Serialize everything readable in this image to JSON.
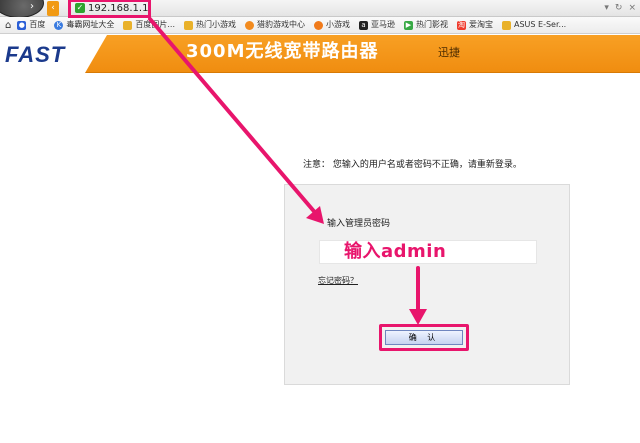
{
  "browser": {
    "url": "192.168.1.1",
    "bookmarks": [
      {
        "label": "百度",
        "icon": "baidu-paw-icon",
        "color": "#2b5fd6"
      },
      {
        "label": "毒霸网址大全",
        "icon": "kingsoft-icon",
        "color": "#3a7be0"
      },
      {
        "label": "百度图片...",
        "icon": "folder-icon",
        "color": "#e9b12a"
      },
      {
        "label": "热门小游戏",
        "icon": "folder-icon",
        "color": "#e9b12a"
      },
      {
        "label": "猎豹游戏中心",
        "icon": "game-icon",
        "color": "#f28b1f"
      },
      {
        "label": "小游戏",
        "icon": "game-icon",
        "color": "#f07a1a"
      },
      {
        "label": "亚马逊",
        "icon": "amazon-icon",
        "color": "#222222"
      },
      {
        "label": "热门影视",
        "icon": "video-icon",
        "color": "#37a844"
      },
      {
        "label": "爱淘宝",
        "icon": "taobao-icon",
        "color": "#ef3b2d"
      },
      {
        "label": "ASUS E-Ser...",
        "icon": "folder-icon",
        "color": "#e9b12a"
      }
    ]
  },
  "header": {
    "logo": "FAST",
    "product_title": "300M无线宽带路由器",
    "brand_sub": "迅捷"
  },
  "login": {
    "notice": "注意： 您输入的用户名或者密码不正确，请重新登录。",
    "password_label": "输入管理员密码",
    "annotation_text": "输入admin",
    "forgot_link": "忘记密码？",
    "confirm_label": "确 认"
  },
  "colors": {
    "accent_orange": "#f39a1e",
    "annotation_pink": "#e8156c",
    "logo_blue": "#1b3a8c"
  }
}
